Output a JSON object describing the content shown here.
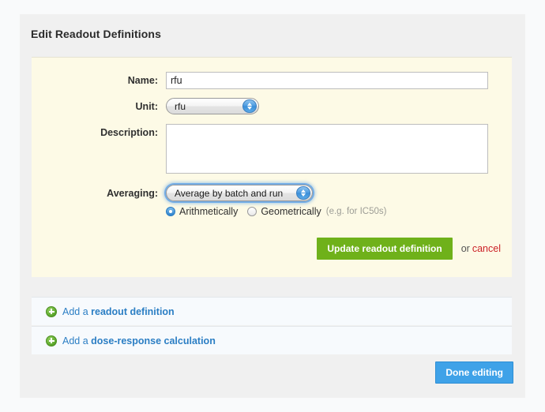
{
  "panel": {
    "title": "Edit Readout Definitions"
  },
  "form": {
    "name": {
      "label": "Name:",
      "value": "rfu",
      "placeholder": ""
    },
    "unit": {
      "label": "Unit:",
      "selected": "rfu"
    },
    "description": {
      "label": "Description:",
      "value": "",
      "placeholder": ""
    },
    "averaging": {
      "label": "Averaging:",
      "selected": "Average by batch and run",
      "options": [
        {
          "label": "Arithmetically",
          "checked": true
        },
        {
          "label": "Geometrically",
          "checked": false
        }
      ],
      "hint": "(e.g. for IC50s)"
    },
    "actions": {
      "submit_label": "Update readout definition",
      "or_text": "or",
      "cancel_label": "cancel"
    }
  },
  "add_rows": [
    {
      "icon": "plus-circle-icon",
      "prefix": "Add a ",
      "noun": "readout definition"
    },
    {
      "icon": "plus-circle-icon",
      "prefix": "Add a ",
      "noun": "dose-response calculation"
    }
  ],
  "footer": {
    "done_label": "Done editing"
  },
  "colors": {
    "submit_green": "#6fb11a",
    "done_blue": "#3fa2e8",
    "cancel_red": "#cc2127",
    "link_blue": "#2b7ec4",
    "form_cream": "#fdfae6",
    "panel_gray": "#f0f0f0"
  }
}
